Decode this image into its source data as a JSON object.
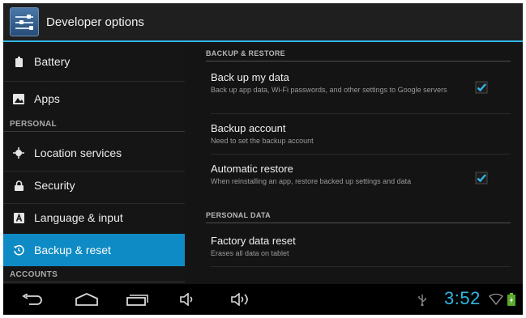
{
  "actionbar": {
    "title": "Developer options",
    "icon": "settings-sliders-icon"
  },
  "left_nav": {
    "items": [
      {
        "label": "Battery",
        "icon": "battery-icon"
      },
      {
        "label": "Apps",
        "icon": "apps-image-icon"
      },
      {
        "label": "Location services",
        "icon": "location-target-icon"
      },
      {
        "label": "Security",
        "icon": "lock-icon"
      },
      {
        "label": "Language & input",
        "icon": "keyboard-a-icon"
      },
      {
        "label": "Backup & reset",
        "icon": "backup-restore-icon",
        "active": true
      }
    ],
    "headers": {
      "personal": "PERSONAL",
      "accounts": "ACCOUNTS"
    }
  },
  "content": {
    "backup_header": "BACKUP & RESTORE",
    "personal_data_header": "PERSONAL DATA",
    "prefs": [
      {
        "title": "Back up my data",
        "summary": "Back up app data, Wi-Fi passwords, and other settings to Google servers",
        "checked": true
      },
      {
        "title": "Backup account",
        "summary": "Need to set the backup account"
      },
      {
        "title": "Automatic restore",
        "summary": "When reinstalling an app, restore backed up settings and data",
        "checked": true
      },
      {
        "title": "Factory data reset",
        "summary": "Erases all data on tablet"
      }
    ]
  },
  "navbar": {
    "buttons": [
      "back-icon",
      "home-icon",
      "recent-apps-icon",
      "volume-down-icon",
      "volume-up-icon"
    ],
    "status_icons": [
      "usb-icon",
      "wifi-icon",
      "battery-charging-icon"
    ],
    "time": "3:52"
  },
  "colors": {
    "accent": "#33b5e5",
    "active_item": "#0e8bc4",
    "background": "#141414"
  }
}
